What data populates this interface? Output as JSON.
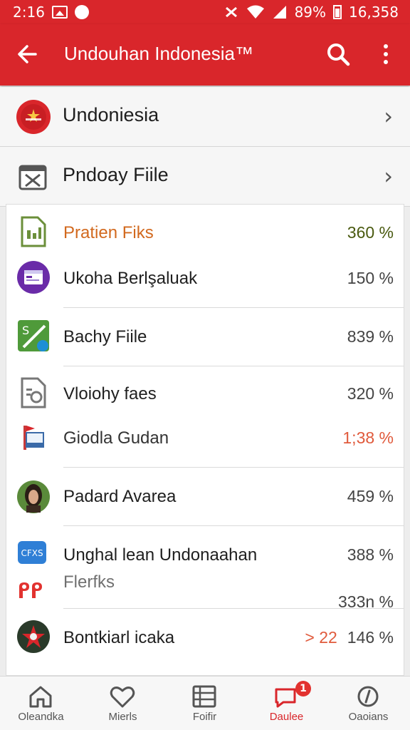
{
  "status_bar": {
    "time": "2:16",
    "battery": "89%",
    "clock": "16,358"
  },
  "app_bar": {
    "title": "Undouhan Indonesia™"
  },
  "top_rows": [
    {
      "label": "Undoniesia"
    },
    {
      "label": "Pndoay Fiile"
    }
  ],
  "items": [
    {
      "label": "Pratien Fiks",
      "value": "360 %",
      "label_color": "#d2691e",
      "value_color": "#4a5a10"
    },
    {
      "label": "Ukoha Berlşaluak",
      "value": "150 %"
    },
    {
      "label": "Bachy Fiile",
      "value": "839 %"
    },
    {
      "label": "Vloiohy faes",
      "value": "320 %"
    },
    {
      "label": "Giodla Gudan",
      "value": "1;38 %",
      "value_color": "#e05a3c"
    },
    {
      "label": "Padard Avarea",
      "value": "459 %"
    },
    {
      "label": "Unghal lean Undonaahan",
      "value": "388 %",
      "icon_text": "CFXS"
    },
    {
      "label": "Flerfks",
      "value": "333n %",
      "label_color": "#707070"
    },
    {
      "label": "Bontkiarl icaka",
      "value": "146 %",
      "extra": "> 22"
    }
  ],
  "bottom_nav": [
    {
      "label": "Oleandka",
      "icon": "home-icon"
    },
    {
      "label": "Mierls",
      "icon": "heart-icon"
    },
    {
      "label": "Foifir",
      "icon": "list-icon"
    },
    {
      "label": "Daulee",
      "icon": "chat-icon",
      "badge": "1",
      "active": true
    },
    {
      "label": "Oaoians",
      "icon": "circle-icon"
    }
  ],
  "colors": {
    "accent": "#d9262b",
    "background": "#ededed"
  }
}
